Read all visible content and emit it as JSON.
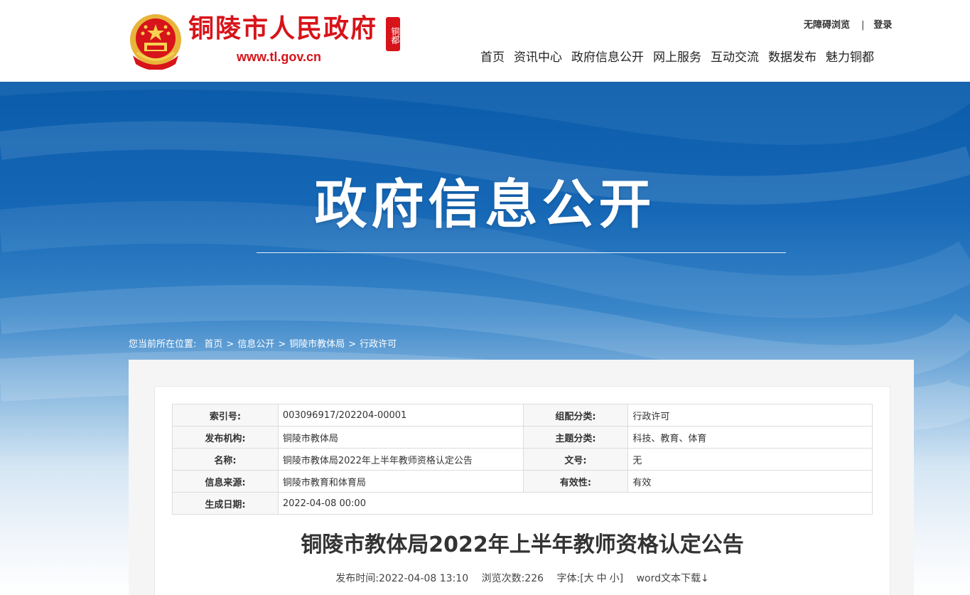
{
  "header": {
    "site_name": "铜陵市人民政府",
    "site_url": "www.tl.gov.cn",
    "seal_text": "铜都",
    "accessibility_link": "无障碍浏览",
    "separator": "|",
    "login_link": "登录",
    "nav": [
      "首页",
      "资讯中心",
      "政府信息公开",
      "网上服务",
      "互动交流",
      "数据发布",
      "魅力铜都"
    ],
    "brand_color": "#d7141a"
  },
  "banner": {
    "title": "政府信息公开",
    "color_top": "#0a5cab"
  },
  "breadcrumb": {
    "label": "您当前所在位置:",
    "items": [
      "首页",
      "信息公开",
      "铜陵市教体局",
      "行政许可"
    ],
    "separator": ">"
  },
  "meta_table": {
    "rows": [
      [
        {
          "k": "索引号:",
          "v": "003096917/202204-00001"
        },
        {
          "k": "组配分类:",
          "v": "行政许可"
        }
      ],
      [
        {
          "k": "发布机构:",
          "v": "铜陵市教体局"
        },
        {
          "k": "主题分类:",
          "v": "科技、教育、体育"
        }
      ],
      [
        {
          "k": "名称:",
          "v": "铜陵市教体局2022年上半年教师资格认定公告"
        },
        {
          "k": "文号:",
          "v": "无"
        }
      ],
      [
        {
          "k": "信息来源:",
          "v": "铜陵市教育和体育局"
        },
        {
          "k": "有效性:",
          "v": "有效"
        }
      ],
      [
        {
          "k": "生成日期:",
          "v": "2022-04-08 00:00"
        }
      ]
    ]
  },
  "article": {
    "title": "铜陵市教体局2022年上半年教师资格认定公告",
    "publish_label": "发布时间:",
    "publish_time": "2022-04-08 13:10",
    "views_label": "浏览次数:",
    "views": "226",
    "font_label": "字体:",
    "font_open": "[",
    "font_large": "大",
    "font_medium": "中",
    "font_small": "小",
    "font_close": "]",
    "download_label": "word文本下载↓"
  }
}
